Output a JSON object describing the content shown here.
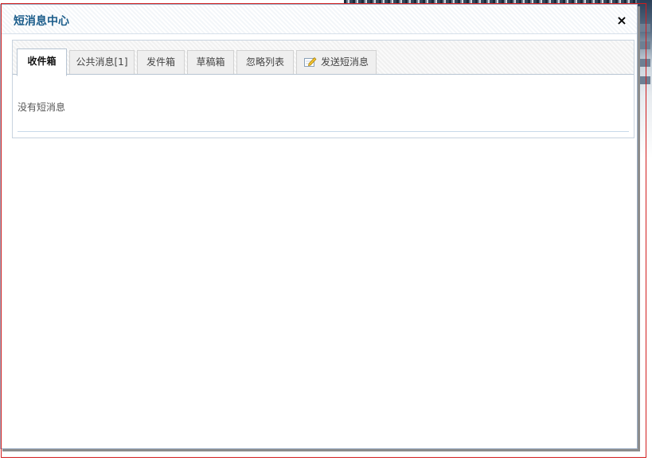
{
  "dialog": {
    "title": "短消息中心",
    "close_label": "×"
  },
  "tabs": [
    {
      "label": "收件箱",
      "active": true
    },
    {
      "label": "公共消息[1]",
      "active": false
    },
    {
      "label": "发件箱",
      "active": false
    },
    {
      "label": "草稿箱",
      "active": false
    },
    {
      "label": "忽略列表",
      "active": false
    },
    {
      "label": "发送短消息",
      "active": false,
      "icon": "pencil-icon"
    }
  ],
  "content": {
    "empty_text": "没有短消息"
  },
  "colors": {
    "title": "#1a5c8a",
    "frame_red": "#d21d1d",
    "border": "#b7c4d2"
  }
}
